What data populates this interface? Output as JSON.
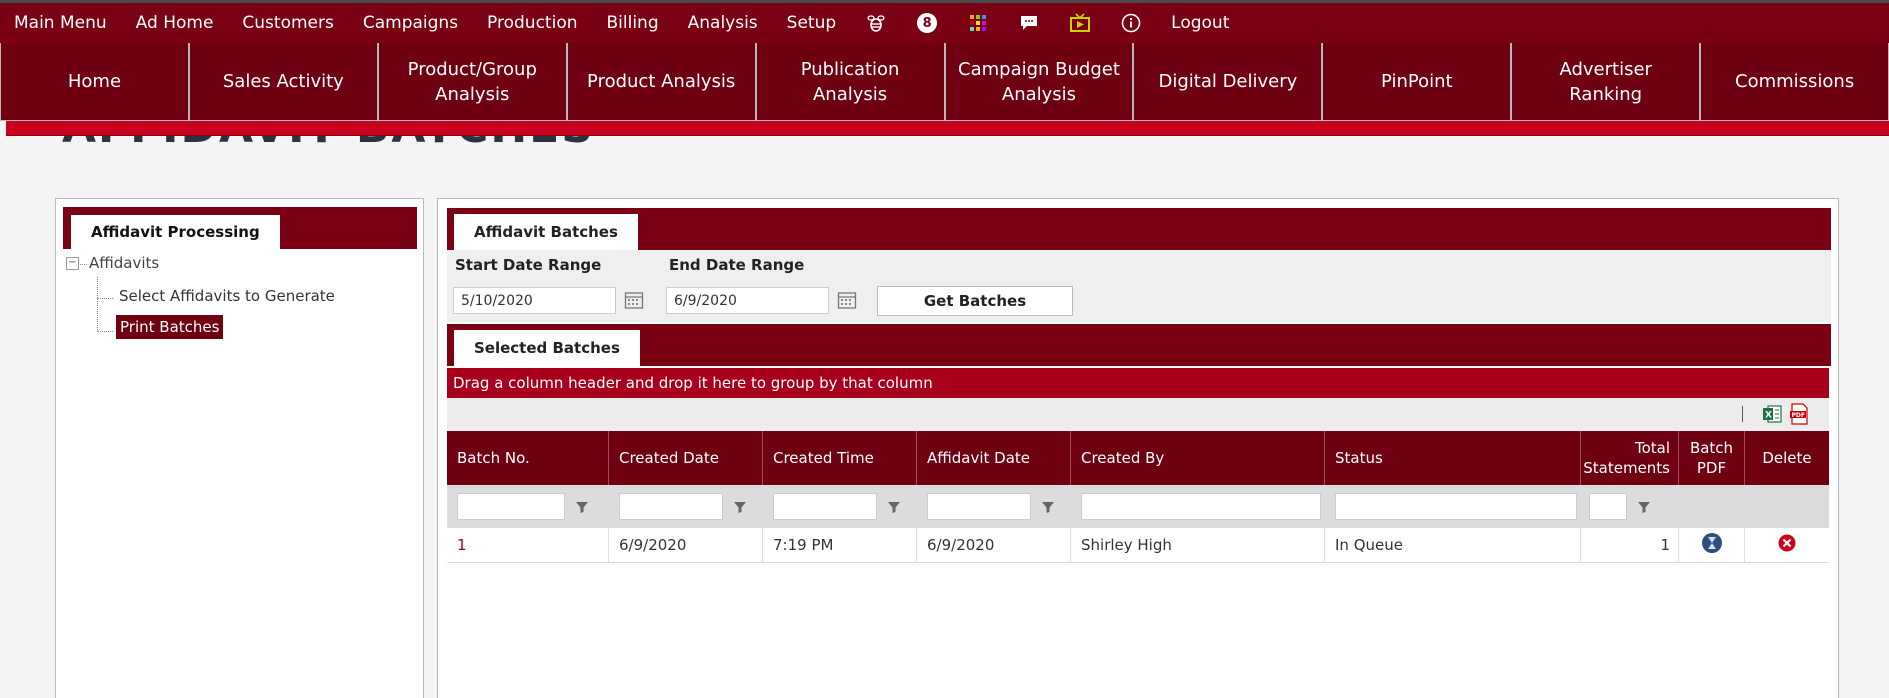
{
  "topbar": {
    "items": [
      "Main Menu",
      "Ad Home",
      "Customers",
      "Campaigns",
      "Production",
      "Billing",
      "Analysis",
      "Setup"
    ],
    "icons": [
      "bee-icon",
      "notification-count-icon",
      "apps-grid-icon",
      "chat-icon",
      "tv-icon",
      "info-icon"
    ],
    "notification_count": "8",
    "logout": "Logout"
  },
  "nav2": {
    "tabs": [
      "Home",
      "Sales Activity",
      "Product/Group Analysis",
      "Product Analysis",
      "Publication Analysis",
      "Campaign Budget Analysis",
      "Digital Delivery",
      "PinPoint",
      "Advertiser Ranking",
      "Commissions"
    ]
  },
  "page": {
    "title": "AFFIDAVIT BATCHES"
  },
  "left": {
    "tab": "Affidavit Processing",
    "tree_root": "Affidavits",
    "tree_children": [
      "Select Affidavits to Generate",
      "Print Batches"
    ],
    "selected_child": "Print Batches"
  },
  "right": {
    "tab": "Affidavit Batches",
    "start_label": "Start Date Range",
    "end_label": "End Date Range",
    "start_value": "5/10/2020",
    "end_value": "6/9/2020",
    "get_button": "Get Batches",
    "selected_tab": "Selected Batches",
    "group_hint": "Drag a column header and drop it here to group by that column"
  },
  "grid": {
    "columns": [
      "Batch No.",
      "Created Date",
      "Created Time",
      "Affidavit Date",
      "Created By",
      "Status",
      "Total Statements",
      "Batch PDF",
      "Delete"
    ],
    "rows": [
      {
        "batch_no": "1",
        "created_date": "6/9/2020",
        "created_time": "7:19 PM",
        "affidavit_date": "6/9/2020",
        "created_by": "Shirley High",
        "status": "In Queue",
        "total": "1"
      }
    ]
  },
  "colors": {
    "brand": "#7a0014",
    "accent": "#c8001e",
    "header_dark": "#6e0012"
  }
}
